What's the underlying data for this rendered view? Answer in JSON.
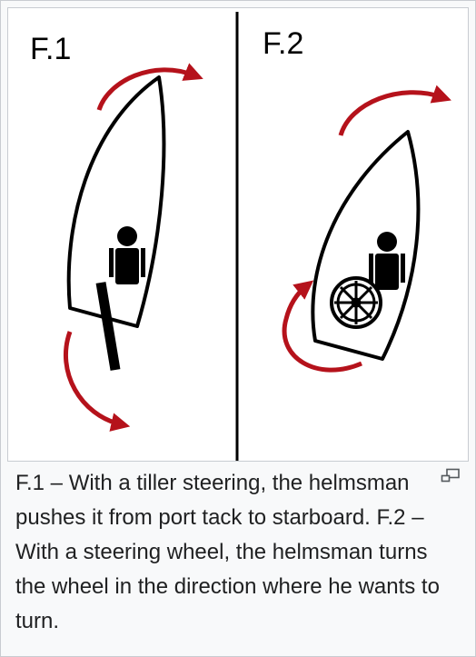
{
  "figure": {
    "panels": [
      {
        "label": "F.1"
      },
      {
        "label": "F.2"
      }
    ],
    "caption": "F.1 – With a tiller steering, the helmsman pushes it from port tack to starboard. F.2 – With a steering wheel, the helmsman turns the wheel in the direction where he wants to turn.",
    "enlarge_icon": "magnify-clip-icon"
  },
  "colors": {
    "arrow": "#b5121b",
    "outline": "#000000",
    "background": "#f8f9fa",
    "border": "#c8ccd1",
    "caption_text": "#202122"
  }
}
